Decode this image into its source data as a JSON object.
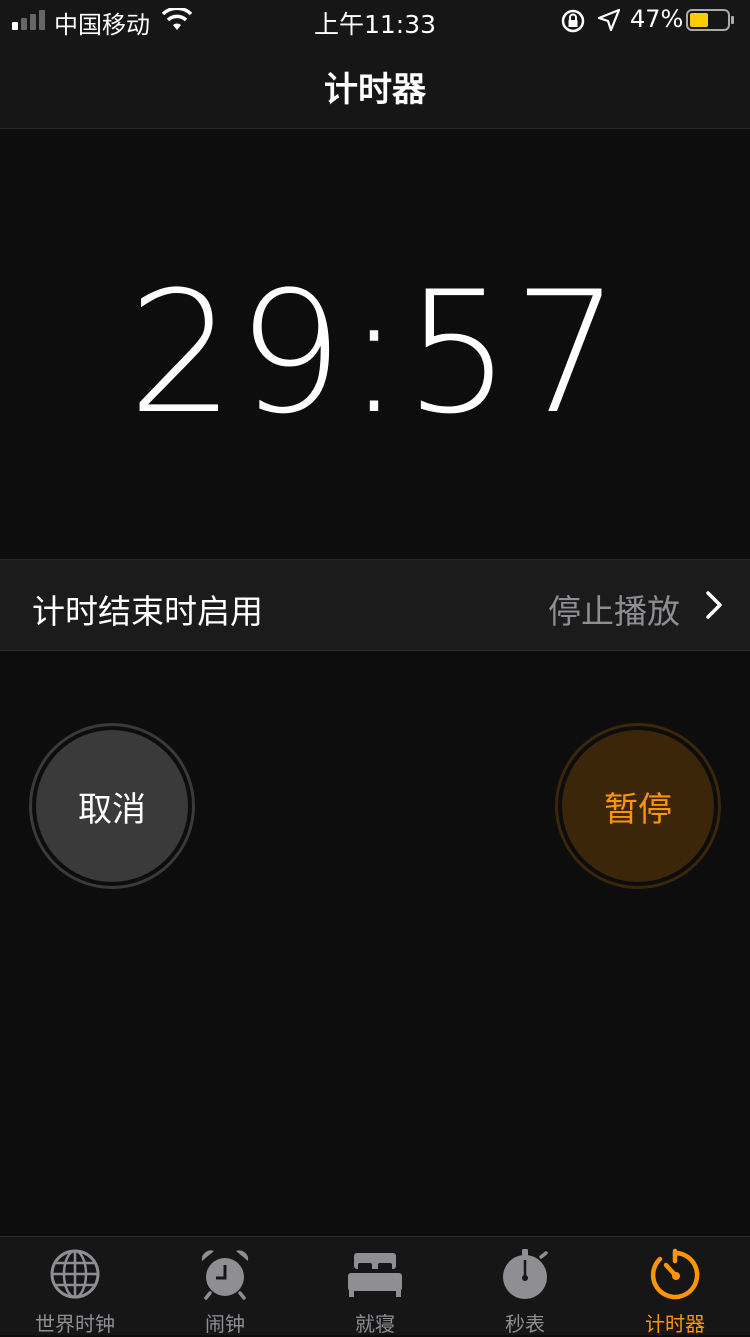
{
  "status_bar": {
    "carrier": "中国移动",
    "time": "上午11:33",
    "battery_percent": "47%",
    "battery_level": 0.47
  },
  "nav": {
    "title": "计时器"
  },
  "timer": {
    "display": "29:57"
  },
  "setting": {
    "label": "计时结束时启用",
    "value": "停止播放"
  },
  "buttons": {
    "cancel": "取消",
    "pause": "暂停"
  },
  "tabs": [
    {
      "label": "世界时钟",
      "icon": "globe-icon"
    },
    {
      "label": "闹钟",
      "icon": "alarm-clock-icon"
    },
    {
      "label": "就寝",
      "icon": "bed-icon"
    },
    {
      "label": "秒表",
      "icon": "stopwatch-icon"
    },
    {
      "label": "计时器",
      "icon": "timer-icon",
      "active": true
    }
  ],
  "colors": {
    "accent": "#ff9500",
    "inactive": "#8e8e93"
  }
}
